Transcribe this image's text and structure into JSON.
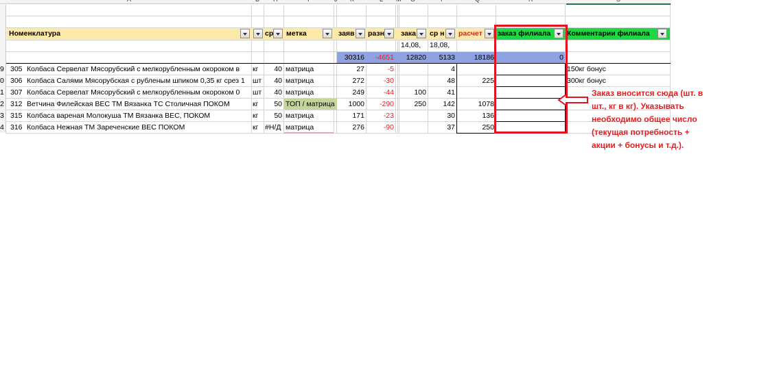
{
  "column_headers": [
    "A",
    "B",
    "H",
    "I",
    "J",
    "K",
    "L",
    "M",
    "O",
    "P",
    "Q",
    "R",
    "S"
  ],
  "row_numbers": [
    "9",
    "0",
    "1",
    "2",
    "3",
    "4"
  ],
  "header": {
    "nomenklatura": "Номенклатура",
    "sr": "ср",
    "metka": "метка",
    "zayav": "заяв",
    "razn": "разн",
    "zakaz": "зака",
    "sr_n": "ср н",
    "raschet": "расчет",
    "zakaz_filiala": "заказ филиала",
    "kommentarii": "Комментарии филиала"
  },
  "dates": [
    "14,08,",
    "18,08,"
  ],
  "totals": [
    "30316",
    "-4651",
    "12820",
    "5133",
    "18186",
    "0"
  ],
  "rows": [
    {
      "code": "305",
      "name": "Колбаса Сервелат Мясорубский с мелкорубленным окороком в",
      "unit": "кг",
      "sr": "40",
      "metka": "матрица",
      "zayav": "27",
      "razn": "-5",
      "zakaz": "",
      "srn": "4",
      "raschet": "",
      "zf": "",
      "comment": "150кг бонус"
    },
    {
      "code": "306",
      "name": "Колбаса Салями Мясорубская с рубленым шпиком 0,35 кг срез 1",
      "unit": "шт",
      "sr": "40",
      "metka": "матрица",
      "zayav": "272",
      "razn": "-30",
      "zakaz": "",
      "srn": "48",
      "raschet": "225",
      "zf": "",
      "comment": "300кг бонус"
    },
    {
      "code": "307",
      "name": "Колбаса Сервелат Мясорубский с мелкорубленным окороком 0",
      "unit": "шт",
      "sr": "40",
      "metka": "матрица",
      "zayav": "249",
      "razn": "-44",
      "zakaz": "100",
      "srn": "41",
      "raschet": "",
      "zf": "",
      "comment": ""
    },
    {
      "code": "312",
      "name": "Ветчина Филейская ВЕС ТМ  Вязанка ТС Столичная  ПОКОМ",
      "unit": "кг",
      "sr": "50",
      "metka": "ТОП / матрица",
      "zayav": "1000",
      "razn": "-290",
      "zakaz": "250",
      "srn": "142",
      "raschet": "1078",
      "zf": "",
      "comment": ""
    },
    {
      "code": "315",
      "name": "Колбаса вареная Молокуша ТМ Вязанка ВЕС, ПОКОМ",
      "unit": "кг",
      "sr": "50",
      "metka": "матрица",
      "zayav": "171",
      "razn": "-23",
      "zakaz": "",
      "srn": "30",
      "raschet": "136",
      "zf": "",
      "comment": ""
    },
    {
      "code": "316",
      "name": "Колбаса Нежная ТМ Зареченские ВЕС  ПОКОМ",
      "unit": "кг",
      "sr": "#Н/Д",
      "metka": "матрица",
      "zayav": "276",
      "razn": "-90",
      "zakaz": "",
      "srn": "37",
      "raschet": "250",
      "zf": "",
      "comment": ""
    }
  ],
  "annotation": {
    "lines": [
      "Заказ вносится сюда (шт. в",
      "шт., кг в кг). Указывать",
      "необходимо общее число",
      "(текущая потребность +",
      "акции + бонусы и т.д.)."
    ],
    "arrow": "left-arrow-icon"
  },
  "colors": {
    "header_yellow": "#fde9a9",
    "filial_green": "#1fd645",
    "totals_blue": "#8ea2e2",
    "metka_green": "#c4d79b",
    "annotation_red": "#e02020",
    "red_box": "#e0141e"
  }
}
